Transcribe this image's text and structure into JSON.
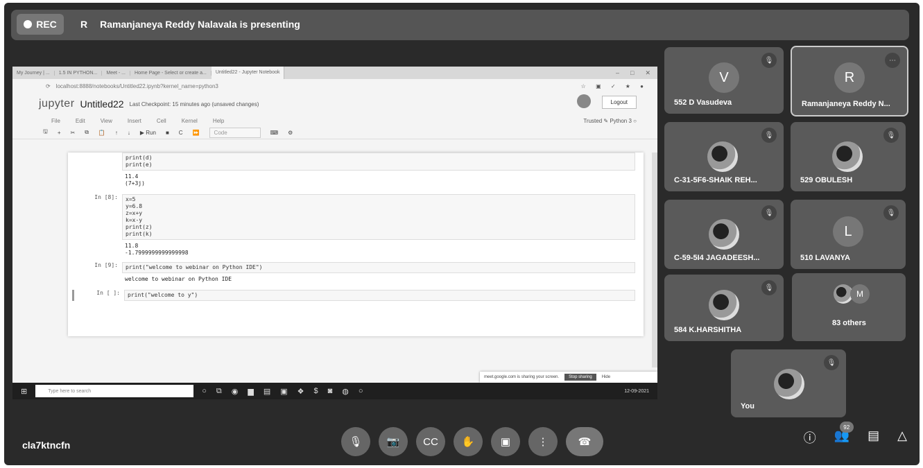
{
  "top": {
    "rec_label": "REC",
    "presenter_initial": "R",
    "presenter_text": "Ramanjaneya Reddy Nalavala is presenting"
  },
  "browser": {
    "tabs": [
      "My Journey | ...",
      "1.5 IN PYTHON...",
      "Meet - ...",
      "Home Page - Select or create a...",
      "Untitled22 - Jupyter Notebook"
    ],
    "url": "localhost:8888/notebooks/Untitled22.ipynb?kernel_name=python3"
  },
  "jupyter": {
    "logo": "jupyter",
    "title": "Untitled22",
    "checkpoint": "Last Checkpoint: 15 minutes ago  (unsaved changes)",
    "logout": "Logout",
    "menu": [
      "File",
      "Edit",
      "View",
      "Insert",
      "Cell",
      "Kernel",
      "Help"
    ],
    "trusted": "Trusted",
    "kernel": "Python 3",
    "run_label": "Run",
    "cell_type": "Code",
    "cells": [
      {
        "prompt": "",
        "code": "print(d)\nprint(e)",
        "output": "11.4\n(7+3j)"
      },
      {
        "prompt": "In [8]:",
        "code": "x=5\ny=6.8\nz=x+y\nk=x-y\nprint(z)\nprint(k)",
        "output": "11.8\n-1.7999999999999998"
      },
      {
        "prompt": "In [9]:",
        "code": "print(\"welcome to webinar on Python IDE\")",
        "output": "welcome to webinar on Python IDE"
      },
      {
        "prompt": "In [ ]:",
        "code": "print(\"welcome to y\")",
        "output": ""
      }
    ]
  },
  "taskbar": {
    "search_placeholder": "Type here to search",
    "notify_text": "meet.google.com is sharing your screen.",
    "stop_sharing": "Stop sharing",
    "hide": "Hide",
    "date": "12-09-2021"
  },
  "participants": [
    {
      "initial": "V",
      "name": "552 D Vasudeva"
    },
    {
      "initial": "R",
      "name": "Ramanjaneya Reddy N..."
    },
    {
      "initial": "",
      "name": "C-31-5F6-SHAIK REH..."
    },
    {
      "initial": "",
      "name": "529 OBULESH"
    },
    {
      "initial": "",
      "name": "C-59-5I4 JAGADEESH..."
    },
    {
      "initial": "L",
      "name": "510 LAVANYA"
    },
    {
      "initial": "",
      "name": "584 K.HARSHITHA"
    },
    {
      "initial": "M",
      "name": "83 others"
    },
    {
      "initial": "",
      "name": "You"
    }
  ],
  "bottom": {
    "meeting_code": "cla7ktncfn",
    "participant_count": "92"
  }
}
